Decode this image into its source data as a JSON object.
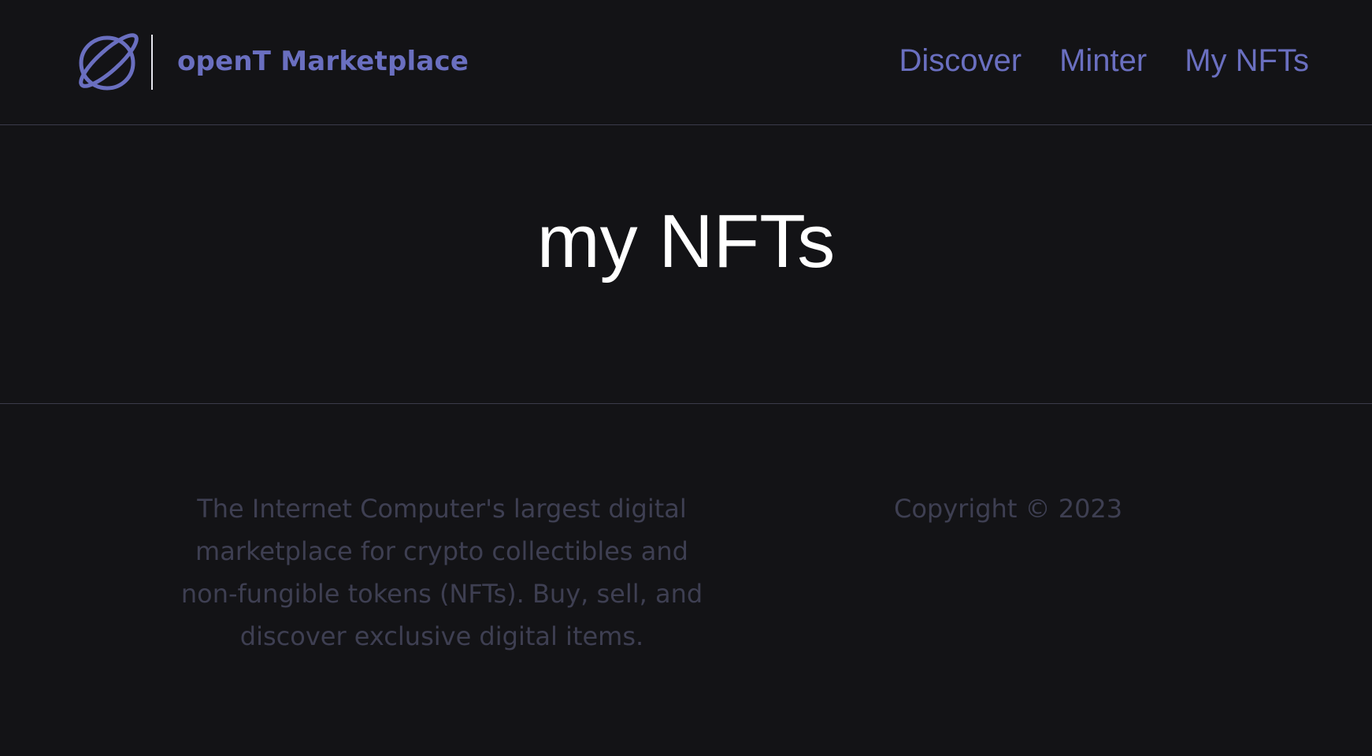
{
  "header": {
    "logo_icon": "planet-icon",
    "brand_name": "openT Marketplace",
    "nav": [
      {
        "label": "Discover"
      },
      {
        "label": "Minter"
      },
      {
        "label": "My NFTs"
      }
    ]
  },
  "main": {
    "title": "my NFTs"
  },
  "footer": {
    "description": "The Internet Computer's largest digital marketplace for crypto collectibles and non-fungible tokens (NFTs). Buy, sell, and discover exclusive digital items.",
    "copyright": "Copyright © 2023"
  },
  "colors": {
    "background": "#131316",
    "accent": "#6a6fc0",
    "title": "#ffffff",
    "footer_text": "#3e3f52",
    "divider": "#3b3b4a"
  }
}
